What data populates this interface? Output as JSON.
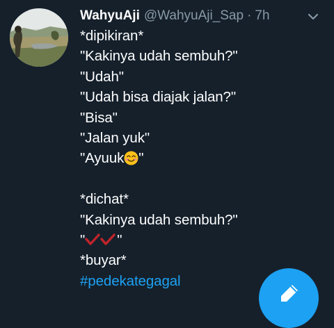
{
  "tweet": {
    "author": {
      "display_name": "WahyuAji",
      "handle": "@WahyuAji_Sap",
      "separator": "·",
      "time": "7h",
      "avatar": "profile-photo-landscape"
    },
    "lines": {
      "l1": "*dipikiran*",
      "l2": "\"Kakinya udah sembuh?\"",
      "l3": "\"Udah\"",
      "l4": "\"Udah bisa diajak jalan?\"",
      "l5": "\"Bisa\"",
      "l6": "\"Jalan yuk\"",
      "l7_pre": "\"Ayuuk",
      "l7_post": "\"",
      "l9": "*dichat*",
      "l10": "\"Kakinya udah sembuh?\"",
      "l11_pre": "\"",
      "l11_post": "\"",
      "l12": "*buyar*",
      "hashtag": "#pedekategagal"
    },
    "icons": {
      "menu": "chevron-down-icon",
      "smile_emoji": "smiling-face-emoji",
      "checks": "red-double-check-marks",
      "compose": "compose-tweet-icon"
    }
  },
  "colors": {
    "background": "#15202b",
    "text": "#ffffff",
    "secondary_text": "#8899a6",
    "accent": "#1da1f2",
    "check_red": "#c0242a"
  }
}
